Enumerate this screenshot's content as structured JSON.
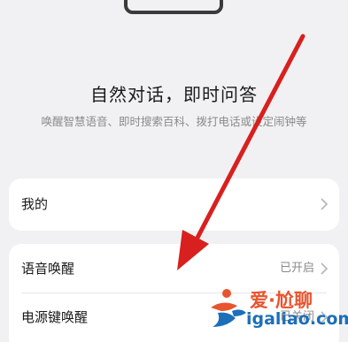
{
  "header": {
    "title": "自然对话，即时问答",
    "subtitle": "唤醒智慧语音、即时搜索百科、拨打电话或设定闹钟等"
  },
  "settings": {
    "mine_label": "我的",
    "voice_wake_label": "语音唤醒",
    "voice_wake_status": "已开启",
    "power_key_label": "电源键唤醒",
    "power_key_status": "已关闭"
  },
  "watermark": {
    "brand_cn": "爱·尬聊",
    "url": "igaliao.com"
  },
  "colors": {
    "arrow": "#d8201e",
    "watermark_orange": "#e8542e",
    "watermark_blue": "#1d6fb8"
  },
  "icons": [
    "chevron-right-icon",
    "watermark-logo-icon",
    "annotation-arrow"
  ]
}
